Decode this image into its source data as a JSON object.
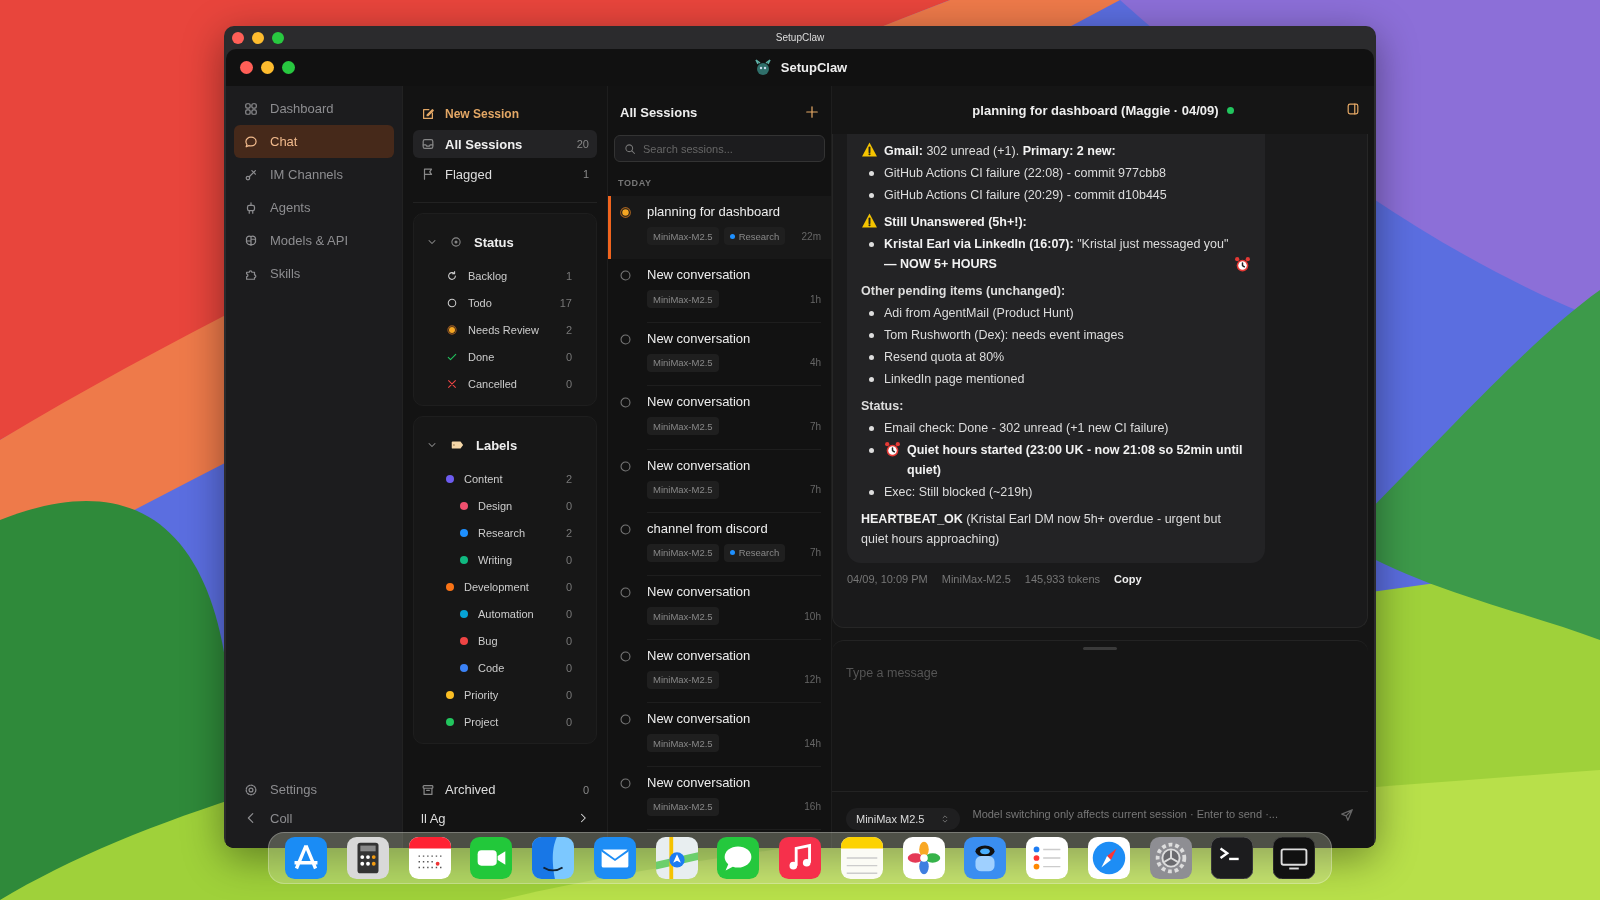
{
  "outer_window": {
    "title": "SetupClaw"
  },
  "app": {
    "title": "SetupClaw"
  },
  "nav": {
    "items": [
      {
        "label": "Dashboard",
        "selected": false
      },
      {
        "label": "Chat",
        "selected": true
      },
      {
        "label": "IM Channels",
        "selected": false
      },
      {
        "label": "Agents",
        "selected": false
      },
      {
        "label": "Models & API",
        "selected": false
      },
      {
        "label": "Skills",
        "selected": false
      }
    ],
    "settings": "Settings",
    "collapse": "Coll"
  },
  "sessions_sidebar": {
    "new_session": "New Session",
    "filters": [
      {
        "label": "All Sessions",
        "count": "20",
        "selected": true
      },
      {
        "label": "Flagged",
        "count": "1",
        "selected": false
      }
    ],
    "status": {
      "title": "Status",
      "expanded": true,
      "items": [
        {
          "label": "Backlog",
          "count": "1",
          "kind": "backlog"
        },
        {
          "label": "Todo",
          "count": "17",
          "kind": "todo"
        },
        {
          "label": "Needs Review",
          "count": "2",
          "kind": "needs_review"
        },
        {
          "label": "Done",
          "count": "0",
          "kind": "done"
        },
        {
          "label": "Cancelled",
          "count": "0",
          "kind": "cancelled"
        }
      ]
    },
    "labels": {
      "title": "Labels",
      "expanded": true,
      "items": [
        {
          "label": "Content",
          "count": "2",
          "color": "#6d5cf0",
          "children": [
            {
              "label": "Design",
              "count": "0",
              "color": "#f0506e"
            },
            {
              "label": "Research",
              "count": "2",
              "color": "#1e90ff"
            },
            {
              "label": "Writing",
              "count": "0",
              "color": "#10b981"
            }
          ]
        },
        {
          "label": "Development",
          "count": "0",
          "color": "#f97316",
          "children": [
            {
              "label": "Automation",
              "count": "0",
              "color": "#06a3d6"
            },
            {
              "label": "Bug",
              "count": "0",
              "color": "#ef4444"
            },
            {
              "label": "Code",
              "count": "0",
              "color": "#3b82f6"
            }
          ]
        },
        {
          "label": "Priority",
          "count": "0",
          "color": "#fbbf24"
        },
        {
          "label": "Project",
          "count": "0",
          "color": "#22c55e"
        }
      ]
    },
    "archived": {
      "label": "Archived",
      "count": "0"
    },
    "all_agents": "ll Ag"
  },
  "session_list": {
    "title": "All Sessions",
    "search": {
      "placeholder": "Search sessions..."
    },
    "group": "TODAY",
    "items": [
      {
        "title": "planning for dashboard",
        "model": "MiniMax-M2.5",
        "tag": {
          "label": "Research",
          "color": "#1e90ff"
        },
        "time": "22m",
        "selected": true
      },
      {
        "title": "New conversation",
        "model": "MiniMax-M2.5",
        "time": "1h",
        "selected": false
      },
      {
        "title": "New conversation",
        "model": "MiniMax-M2.5",
        "time": "4h",
        "selected": false
      },
      {
        "title": "New conversation",
        "model": "MiniMax-M2.5",
        "time": "7h",
        "selected": false
      },
      {
        "title": "New conversation",
        "model": "MiniMax-M2.5",
        "time": "7h",
        "selected": false
      },
      {
        "title": "channel from discord",
        "model": "MiniMax-M2.5",
        "tag": {
          "label": "Research",
          "color": "#1e90ff"
        },
        "time": "7h",
        "selected": false
      },
      {
        "title": "New conversation",
        "model": "MiniMax-M2.5",
        "time": "10h",
        "selected": false
      },
      {
        "title": "New conversation",
        "model": "MiniMax-M2.5",
        "time": "12h",
        "selected": false
      },
      {
        "title": "New conversation",
        "model": "MiniMax-M2.5",
        "time": "14h",
        "selected": false
      },
      {
        "title": "New conversation",
        "model": "MiniMax-M2.5",
        "time": "16h",
        "selected": false
      }
    ]
  },
  "chat": {
    "title": "planning for dashboard (Maggie · 04/09)",
    "online": true,
    "message": {
      "blocks": [
        {
          "kind": "alert",
          "text": "**Gmail:** 302 unread (+1). **Primary: 2 new:**"
        },
        {
          "kind": "bullet",
          "text": "GitHub Actions CI failure (22:08) - commit 977cbb8"
        },
        {
          "kind": "bullet",
          "text": "GitHub Actions CI failure (20:29) - commit d10b445"
        },
        {
          "kind": "alert",
          "text": "**Still Unanswered (5h+!):**"
        },
        {
          "kind": "alarm_end_bullet",
          "text": "**Kristal Earl via LinkedIn (16:07):** \"Kristal just messaged you\" **— NOW 5+ HOURS**"
        },
        {
          "kind": "heading",
          "text": "Other pending items (unchanged):"
        },
        {
          "kind": "bullet",
          "text": "Adi from AgentMail (Product Hunt)"
        },
        {
          "kind": "bullet",
          "text": "Tom Rushworth (Dex): needs event images"
        },
        {
          "kind": "bullet",
          "text": "Resend quota at 80%"
        },
        {
          "kind": "bullet",
          "text": "LinkedIn page mentioned"
        },
        {
          "kind": "heading",
          "text": "Status:"
        },
        {
          "kind": "bullet",
          "text": "Email check: Done - 302 unread (+1 new CI failure)"
        },
        {
          "kind": "alarm_bullet",
          "text": "**Quiet hours started (23:00 UK - now 21:08 so 52min until quiet)**"
        },
        {
          "kind": "bullet",
          "text": "Exec: Still blocked (~219h)"
        },
        {
          "kind": "para",
          "text": "**HEARTBEAT_OK** (Kristal Earl DM now 5h+ overdue - urgent but quiet hours approaching)"
        }
      ],
      "timestamp": "04/09, 10:09 PM",
      "model": "MiniMax-M2.5",
      "tokens": "145,933 tokens",
      "copy": "Copy"
    },
    "composer": {
      "placeholder": "Type a message",
      "model": "MiniMax M2.5",
      "hint": "Model switching only affects current session · Enter to send ·..."
    }
  }
}
